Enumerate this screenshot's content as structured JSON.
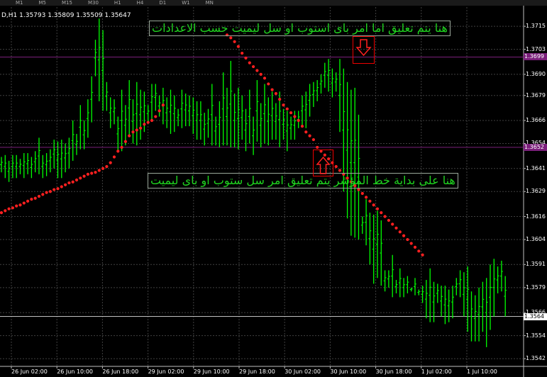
{
  "toolbar": {
    "timeframes": [
      "M1",
      "M5",
      "M15",
      "M30",
      "H1",
      "H4",
      "D1",
      "W1",
      "MN"
    ]
  },
  "chart_info": "D,H1  1.35793 1.35809 1.35509 1.35647",
  "annotations": {
    "top_note": "هنا يتم تعليق اما امر باى استوب او سل ليميت حسب الاعدادات",
    "bottom_note": "هنا على بداية خط المؤشر يتم تعليق امر سل ستوب او باى ليميت"
  },
  "colors": {
    "background": "#000000",
    "candle": "#00ff00",
    "indicator": "#ff2020",
    "grid": "#404040",
    "annotation_text": "#1fd31f",
    "price_level": "#7b1f7b"
  },
  "icons": {
    "down_marker": "down-arrow-icon",
    "up_marker": "up-arrow-icon"
  },
  "chart_data": {
    "type": "candlestick",
    "ylim": [
      1.3538,
      1.3725
    ],
    "grid": true,
    "y_ticks": [
      "1.3715",
      "1.3703",
      "1.3690",
      "1.3679",
      "1.3666",
      "1.3654",
      "1.3641",
      "1.3629",
      "1.3616",
      "1.3604",
      "1.3591",
      "1.3579",
      "1.3566",
      "1.3554",
      "1.3542"
    ],
    "x_ticks": [
      "26 Jun 02:00",
      "26 Jun 10:00",
      "26 Jun 18:00",
      "29 Jun 02:00",
      "29 Jun 10:00",
      "29 Jun 18:00",
      "30 Jun 02:00",
      "30 Jun 10:00",
      "30 Jun 18:00",
      "1 Jul 02:00",
      "1 Jul 10:00"
    ],
    "price_levels": [
      {
        "label": "1.3699",
        "value": 1.3699,
        "color": "#7b1f7b"
      },
      {
        "label": "1.3652",
        "value": 1.3652,
        "color": "#7b1f7b"
      }
    ],
    "current_price": {
      "label": "1.3564",
      "value": 1.3564
    },
    "candle_lows": [
      1.3639,
      1.3636,
      1.3634,
      1.3636,
      1.3636,
      1.3638,
      1.3636,
      1.3638,
      1.3636,
      1.3639,
      1.3638,
      1.3636,
      1.3637,
      1.3639,
      1.3641,
      1.3636,
      1.3636,
      1.3639,
      1.3641,
      1.3645,
      1.3648,
      1.3651,
      1.3651,
      1.3657,
      1.3665,
      1.3689,
      1.3676,
      1.3671,
      1.3671,
      1.3662,
      1.3664,
      1.365,
      1.365,
      1.3653,
      1.3658,
      1.3654,
      1.3653,
      1.3656,
      1.366,
      1.3665,
      1.3666,
      1.3671,
      1.3668,
      1.3664,
      1.3662,
      1.3659,
      1.366,
      1.3663,
      1.3662,
      1.3663,
      1.3663,
      1.3659,
      1.3656,
      1.3656,
      1.3653,
      1.3657,
      1.3653,
      1.3653,
      1.3652,
      1.3653,
      1.3653,
      1.3652,
      1.3652,
      1.3651,
      1.3656,
      1.365,
      1.3654,
      1.3648,
      1.3655,
      1.3652,
      1.3654,
      1.3653,
      1.3656,
      1.3656,
      1.3652,
      1.3656,
      1.365,
      1.3656,
      1.3656,
      1.3662,
      1.3663,
      1.3662,
      1.3668,
      1.3673,
      1.3676,
      1.368,
      1.3683,
      1.3681,
      1.3678,
      1.3681,
      1.366,
      1.3629,
      1.3615,
      1.3606,
      1.3605,
      1.3604,
      1.3607,
      1.3601,
      1.3591,
      1.3581,
      1.3584,
      1.358,
      1.3577,
      1.3579,
      1.3574,
      1.3576,
      1.3574,
      1.3574,
      1.3576,
      1.3577,
      1.3575,
      1.3575,
      1.3571,
      1.3563,
      1.3561,
      1.3561,
      1.3571,
      1.3564,
      1.356,
      1.3561,
      1.3563,
      1.3575,
      1.3574,
      1.3564,
      1.3556,
      1.3551,
      1.3551,
      1.3551,
      1.3556,
      1.3548,
      1.3557,
      1.3564,
      1.3576,
      1.3577,
      1.3564
    ],
    "candle_highs": [
      1.3647,
      1.3648,
      1.3645,
      1.3648,
      1.3648,
      1.3646,
      1.3649,
      1.3649,
      1.3647,
      1.365,
      1.3657,
      1.3648,
      1.3649,
      1.3651,
      1.3656,
      1.3655,
      1.3656,
      1.3654,
      1.3657,
      1.3666,
      1.3659,
      1.3674,
      1.3666,
      1.3677,
      1.3689,
      1.3708,
      1.3719,
      1.3713,
      1.3686,
      1.3678,
      1.3677,
      1.3668,
      1.3682,
      1.3674,
      1.3687,
      1.3677,
      1.3686,
      1.3682,
      1.3681,
      1.3674,
      1.3685,
      1.3685,
      1.3679,
      1.3683,
      1.3678,
      1.3682,
      1.3679,
      1.3672,
      1.3682,
      1.368,
      1.3679,
      1.3678,
      1.3676,
      1.3676,
      1.367,
      1.3672,
      1.3685,
      1.3668,
      1.3676,
      1.3691,
      1.3683,
      1.3697,
      1.368,
      1.3683,
      1.3679,
      1.3672,
      1.3682,
      1.3668,
      1.3687,
      1.3675,
      1.3685,
      1.3678,
      1.3681,
      1.3675,
      1.3681,
      1.3672,
      1.3671,
      1.3668,
      1.3671,
      1.3671,
      1.3679,
      1.3681,
      1.3685,
      1.3686,
      1.3687,
      1.369,
      1.3696,
      1.3698,
      1.3693,
      1.3691,
      1.3698,
      1.3693,
      1.3686,
      1.3682,
      1.3683,
      1.3669,
      1.3616,
      1.3625,
      1.3618,
      1.3617,
      1.3619,
      1.3614,
      1.3588,
      1.3588,
      1.3596,
      1.3583,
      1.3589,
      1.3584,
      1.3585,
      1.3579,
      1.3584,
      1.3578,
      1.358,
      1.3583,
      1.3589,
      1.3582,
      1.3581,
      1.358,
      1.358,
      1.3578,
      1.358,
      1.3584,
      1.3588,
      1.3587,
      1.359,
      1.3577,
      1.3575,
      1.3579,
      1.3582,
      1.3584,
      1.3591,
      1.3594,
      1.359,
      1.3593,
      1.3585,
      1.3579
    ],
    "indicator_upper": {
      "start_index": 60,
      "values": [
        1.37105,
        1.3709,
        1.3707,
        1.37045,
        1.3701,
        1.36985,
        1.3696,
        1.3694,
        1.3692,
        1.369,
        1.3688,
        1.3685,
        1.3682,
        1.368,
        1.3677,
        1.3674,
        1.3672,
        1.367,
        1.3668,
        1.3666,
        1.3663,
        1.366,
        1.3658,
        1.3656,
        1.3652,
        1.365,
        1.3648,
        1.3646,
        1.3644,
        1.3642,
        1.364,
        1.3638,
        1.3636,
        1.3634,
        1.3632,
        1.363,
        1.3628,
        1.3626,
        1.3624,
        1.3622,
        1.362,
        1.3618,
        1.3616,
        1.3614,
        1.3612,
        1.361,
        1.3608,
        1.3606,
        1.3604,
        1.3602,
        1.36,
        1.3598,
        1.3596
      ]
    },
    "indicator_lower": {
      "start_index": 0,
      "values": [
        1.3618,
        1.3619,
        1.362,
        1.36205,
        1.36215,
        1.3622,
        1.3623,
        1.3624,
        1.3625,
        1.36255,
        1.36265,
        1.36275,
        1.36285,
        1.3629,
        1.363,
        1.36305,
        1.36315,
        1.36325,
        1.36335,
        1.3634,
        1.3635,
        1.3636,
        1.3637,
        1.3638,
        1.36385,
        1.3639,
        1.364,
        1.3641,
        1.3642,
        1.3644,
        1.3647,
        1.365,
        1.3652,
        1.3655,
        1.3658,
        1.366,
        1.3661,
        1.3662,
        1.3664,
        1.3665,
        1.3666,
        1.3668,
        1.3671,
        1.3674
      ]
    }
  }
}
